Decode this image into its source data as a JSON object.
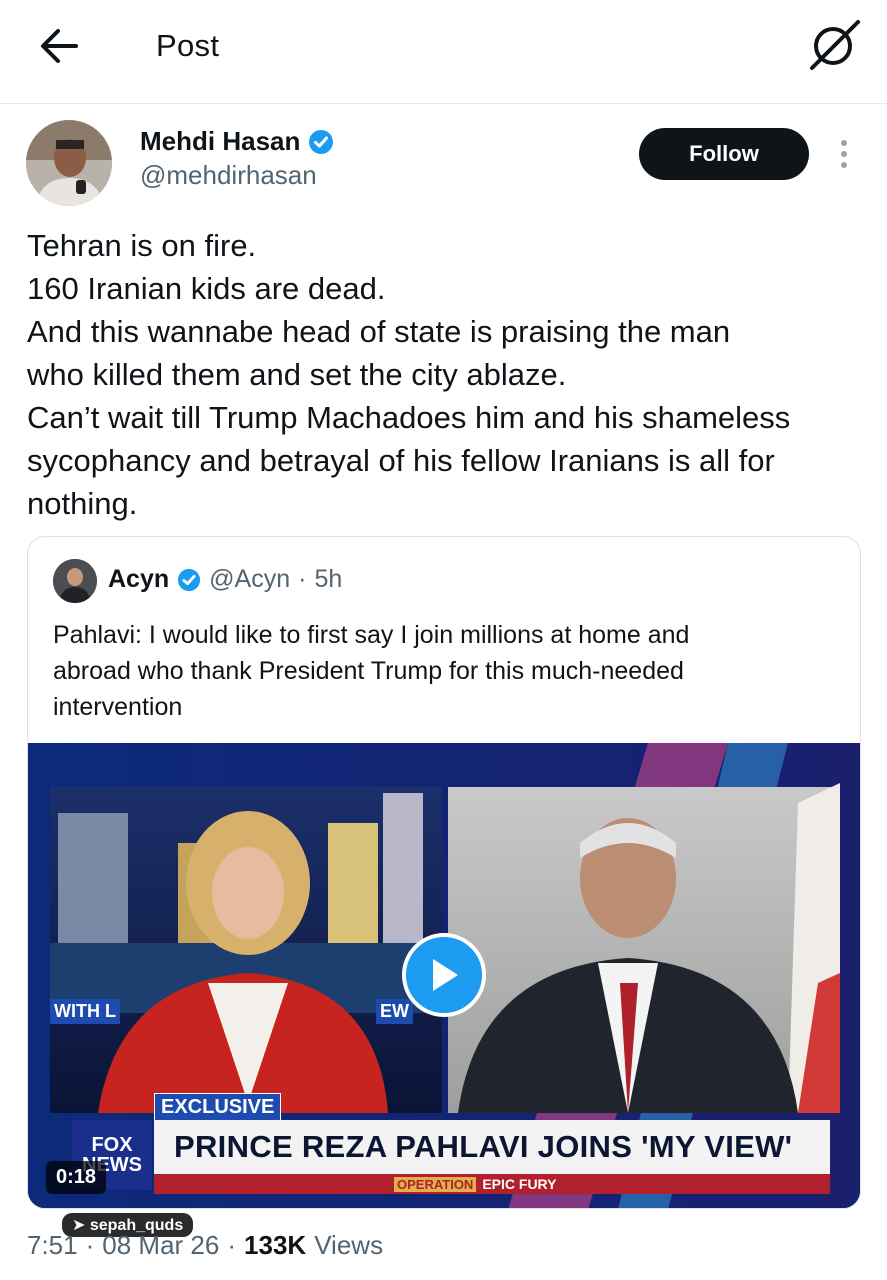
{
  "header": {
    "title": "Post",
    "back_icon": "arrow-left-icon",
    "grok_icon": "grok-icon"
  },
  "author": {
    "name": "Mehdi Hasan",
    "handle": "@mehdirhasan",
    "verified": true,
    "follow_label": "Follow"
  },
  "tweet": {
    "lines": [
      "Tehran is on fire.",
      "160 Iranian kids are dead.",
      "And this wannabe head of state is praising the man",
      "who killed them and set the city ablaze.",
      "Can’t wait till Trump Machadoes him and his shameless",
      "sycophancy and betrayal of his fellow Iranians is all for",
      "nothing."
    ]
  },
  "quote": {
    "name": "Acyn",
    "handle": "@Acyn",
    "separator": "·",
    "time": "5h",
    "lines": [
      "Pahlavi: I would like to first say I join millions at home and",
      "abroad who thank President Trump for this much-needed",
      "intervention"
    ],
    "video": {
      "duration": "0:18",
      "exclusive": "EXCLUSIVE",
      "chyron": "PRINCE REZA PAHLAVI JOINS 'MY VIEW'",
      "network_top": "FOX",
      "network_bottom": "NEWS",
      "ticker_tag": "OPERATION",
      "ticker_text": "EPIC FURY",
      "left_label": "WITH L",
      "mid_label": "EW"
    }
  },
  "watermark": "sepah_quds",
  "footer": {
    "time": "7:51",
    "date": "08 Mar 26",
    "views_count": "133K",
    "views_label": "Views",
    "dot": "·"
  },
  "colors": {
    "text": "#0f1419",
    "muted": "#536471",
    "verified": "#1d9bf0",
    "follow_bg": "#0f1419"
  }
}
